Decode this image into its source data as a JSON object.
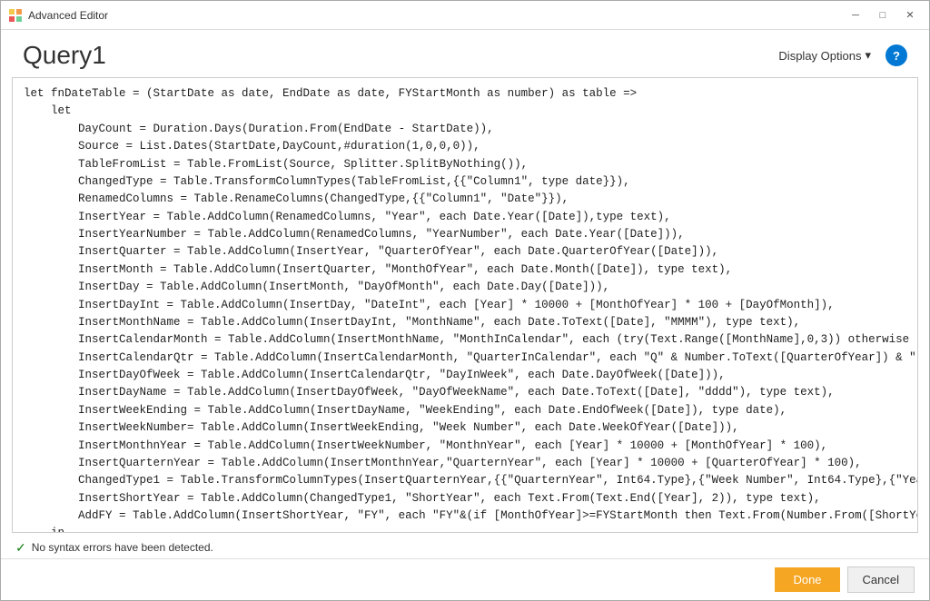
{
  "window": {
    "title": "Advanced Editor",
    "icon": "power-bi-icon"
  },
  "header": {
    "title": "Query1",
    "display_options_label": "Display Options",
    "help_label": "?"
  },
  "code": {
    "content": "let fnDateTable = (StartDate as date, EndDate as date, FYStartMonth as number) as table =>\n    let\n        DayCount = Duration.Days(Duration.From(EndDate - StartDate)),\n        Source = List.Dates(StartDate,DayCount,#duration(1,0,0,0)),\n        TableFromList = Table.FromList(Source, Splitter.SplitByNothing()),\n        ChangedType = Table.TransformColumnTypes(TableFromList,{{\"Column1\", type date}}),\n        RenamedColumns = Table.RenameColumns(ChangedType,{{\"Column1\", \"Date\"}}),\n        InsertYear = Table.AddColumn(RenamedColumns, \"Year\", each Date.Year([Date]),type text),\n        InsertYearNumber = Table.AddColumn(RenamedColumns, \"YearNumber\", each Date.Year([Date])),\n        InsertQuarter = Table.AddColumn(InsertYear, \"QuarterOfYear\", each Date.QuarterOfYear([Date])),\n        InsertMonth = Table.AddColumn(InsertQuarter, \"MonthOfYear\", each Date.Month([Date]), type text),\n        InsertDay = Table.AddColumn(InsertMonth, \"DayOfMonth\", each Date.Day([Date])),\n        InsertDayInt = Table.AddColumn(InsertDay, \"DateInt\", each [Year] * 10000 + [MonthOfYear] * 100 + [DayOfMonth]),\n        InsertMonthName = Table.AddColumn(InsertDayInt, \"MonthName\", each Date.ToText([Date], \"MMMM\"), type text),\n        InsertCalendarMonth = Table.AddColumn(InsertMonthName, \"MonthInCalendar\", each (try(Text.Range([MonthName],0,3)) otherwise [MonthName]) &\n        InsertCalendarQtr = Table.AddColumn(InsertCalendarMonth, \"QuarterInCalendar\", each \"Q\" & Number.ToText([QuarterOfYear]) & \" \" & Number.To\n        InsertDayOfWeek = Table.AddColumn(InsertCalendarQtr, \"DayInWeek\", each Date.DayOfWeek([Date])),\n        InsertDayName = Table.AddColumn(InsertDayOfWeek, \"DayOfWeekName\", each Date.ToText([Date], \"dddd\"), type text),\n        InsertWeekEnding = Table.AddColumn(InsertDayName, \"WeekEnding\", each Date.EndOfWeek([Date]), type date),\n        InsertWeekNumber= Table.AddColumn(InsertWeekEnding, \"Week Number\", each Date.WeekOfYear([Date])),\n        InsertMonthnYear = Table.AddColumn(InsertWeekNumber, \"MonthnYear\", each [Year] * 10000 + [MonthOfYear] * 100),\n        InsertQuarternYear = Table.AddColumn(InsertMonthnYear,\"QuarternYear\", each [Year] * 10000 + [QuarterOfYear] * 100),\n        ChangedType1 = Table.TransformColumnTypes(InsertQuarternYear,{{\"QuarternYear\", Int64.Type},{\"Week Number\", Int64.Type},{\"Year\", type text\n        InsertShortYear = Table.AddColumn(ChangedType1, \"ShortYear\", each Text.From(Text.End([Year], 2)), type text),\n        AddFY = Table.AddColumn(InsertShortYear, \"FY\", each \"FY\"&(if [MonthOfYear]>=FYStartMonth then Text.From(Number.From([ShortYear])+1) else\n    in\n\n        AddFY\n    in\n        fnDateTable"
  },
  "status": {
    "message": "No syntax errors have been detected."
  },
  "footer": {
    "done_label": "Done",
    "cancel_label": "Cancel"
  },
  "window_controls": {
    "minimize": "─",
    "maximize": "□",
    "close": "✕"
  }
}
